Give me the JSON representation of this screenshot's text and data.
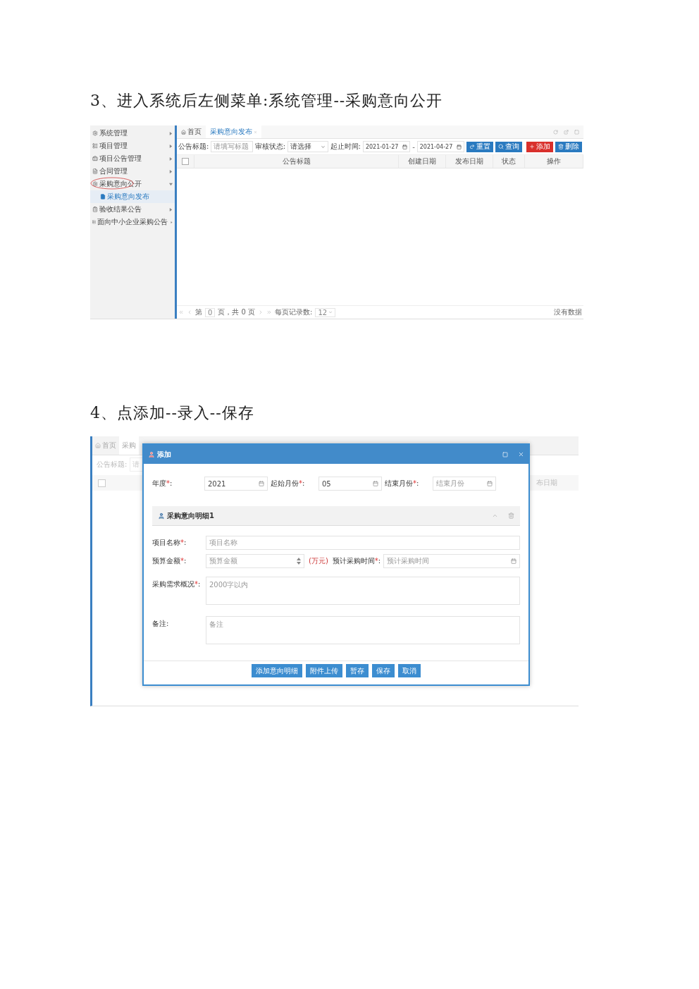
{
  "step3": {
    "heading": "3、进入系统后左侧菜单:系统管理--采购意向公开",
    "sidebar": [
      {
        "label": "系统管理",
        "expanded": false,
        "selected": false
      },
      {
        "label": "项目管理",
        "expanded": false,
        "selected": false
      },
      {
        "label": "项目公告管理",
        "expanded": false,
        "selected": false
      },
      {
        "label": "合同管理",
        "expanded": false,
        "selected": false
      },
      {
        "label": "采购意向公开",
        "expanded": true,
        "selected": false,
        "annotated": true,
        "children": [
          {
            "label": "采购意向发布",
            "selected": true
          }
        ]
      },
      {
        "label": "验收结果公告",
        "expanded": false,
        "selected": false
      },
      {
        "label": "面向中小企业采购公告",
        "expanded": false,
        "selected": false
      }
    ],
    "tabs": [
      {
        "label": "首页",
        "selected": false
      },
      {
        "label": "采购意向发布",
        "selected": true
      }
    ],
    "filters": [
      {
        "kind": "text",
        "label": "公告标题:",
        "placeholder": "请填写标题"
      },
      {
        "kind": "select",
        "label": "审核状态:",
        "value": "请选择"
      },
      {
        "kind": "daterange",
        "label": "起止时间:",
        "from": "2021-01-27",
        "separator": "-",
        "to": "2021-04-27"
      }
    ],
    "buttons": [
      {
        "kind": "reset",
        "label": "重置"
      },
      {
        "kind": "search",
        "label": "查询"
      },
      {
        "kind": "add",
        "label": "添加"
      },
      {
        "kind": "delete",
        "label": "删除"
      }
    ],
    "table": {
      "select_all_checked": false,
      "columns": [
        "公告标题",
        "创建日期",
        "发布日期",
        "状态",
        "操作"
      ]
    },
    "pager": {
      "page_prefix": "第",
      "page": "0",
      "page_suffix": "页，共 0 页",
      "page_size_label": "每页记录数:",
      "page_size": "12",
      "empty": "没有数据"
    }
  },
  "step4": {
    "heading": "4、点添加--录入--保存",
    "background": {
      "tabs": [
        {
          "label": "首页",
          "selected": false
        },
        {
          "label": "采购",
          "selected": true
        }
      ],
      "filter_label": "公告标题:",
      "filter_placeholder": "请",
      "select_all_checked": false,
      "column": "布日期"
    },
    "dialog": {
      "title": "添加",
      "header_fields": [
        {
          "label": "年度",
          "star": "*",
          "colon": ":",
          "value": "2021"
        },
        {
          "label": "起始月份",
          "star": "*",
          "colon": ":",
          "value": "05"
        },
        {
          "label": "结束月份",
          "star": "*",
          "colon": ":",
          "placeholder": "结束月份"
        }
      ],
      "section": {
        "title": "采购意向明细1",
        "expanded": true
      },
      "fields": [
        {
          "kind": "text",
          "label": "项目名称",
          "star": "*",
          "colon": ":",
          "placeholder": "项目名称"
        },
        {
          "kind": "money",
          "label": "预算金额",
          "star": "*",
          "colon": ":",
          "placeholder": "预算金额",
          "unit": "(万元)",
          "date_label": "预计采购时间",
          "date_star": "*",
          "date_colon": ":",
          "date_placeholder": "预计采购时间"
        },
        {
          "kind": "textarea",
          "label": "采购需求概况",
          "star": "*",
          "colon": ":",
          "placeholder": "2000字以内"
        },
        {
          "kind": "textarea",
          "label": "备注",
          "colon": ":",
          "placeholder": "备注"
        }
      ],
      "buttons": [
        "添加意向明细",
        "附件上传",
        "暂存",
        "保存",
        "取消"
      ]
    }
  }
}
